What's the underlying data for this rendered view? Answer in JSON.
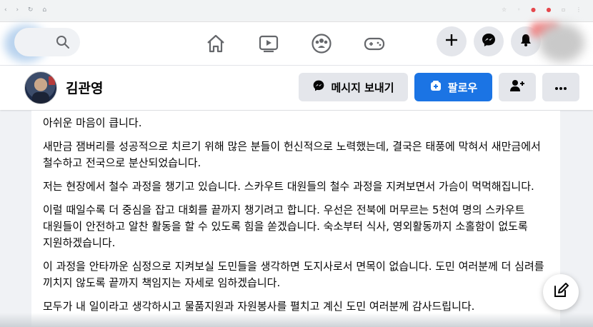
{
  "profile": {
    "name": "김관영"
  },
  "actions": {
    "message_label": "메시지 보내기",
    "follow_label": "팔로우"
  },
  "post": {
    "paragraphs": [
      "아쉬운 마음이 큽니다.",
      "새만금 잼버리를 성공적으로 치르기 위해 많은 분들이 헌신적으로 노력했는데, 결국은 태풍에 막혀서 새만금에서 철수하고 전국으로 분산되었습니다.",
      "저는 현장에서 철수 과정을 챙기고 있습니다. 스카우트 대원들의 철수 과정을 지켜보면서 가슴이 먹먹해집니다.",
      "이럴 때일수록 더 중심을 잡고 대회를 끝까지 챙기려고 합니다. 우선은 전북에 머무르는 5천여 명의 스카우트 대원들이 안전하고 알찬 활동을 할 수 있도록 힘을 쏟겠습니다. 숙소부터 식사, 영외활동까지 소홀함이 없도록 지원하겠습니다.",
      "이 과정을 안타까운 심정으로 지켜보실 도민들을 생각하면 도지사로서 면목이 없습니다. 도민 여러분께 더 심려를 끼치지 않도록 끝까지 책임지는 자세로 임하겠습니다.",
      "모두가 내 일이라고 생각하시고 물품지원과 자원봉사를 펼치고 계신 도민 여러분께 감사드립니다."
    ]
  },
  "colors": {
    "accent": "#1b74e4",
    "button_gray": "#e4e6eb",
    "page_bg": "#f0f2f5"
  },
  "icons": {
    "nav": [
      "home-icon",
      "video-icon",
      "groups-icon",
      "gaming-icon"
    ],
    "right": [
      "plus-icon",
      "messenger-icon",
      "notifications-icon"
    ],
    "profile_actions": [
      "messenger-icon",
      "follow-icon",
      "add-friend-icon",
      "more-icon"
    ],
    "floating": "compose-icon"
  }
}
